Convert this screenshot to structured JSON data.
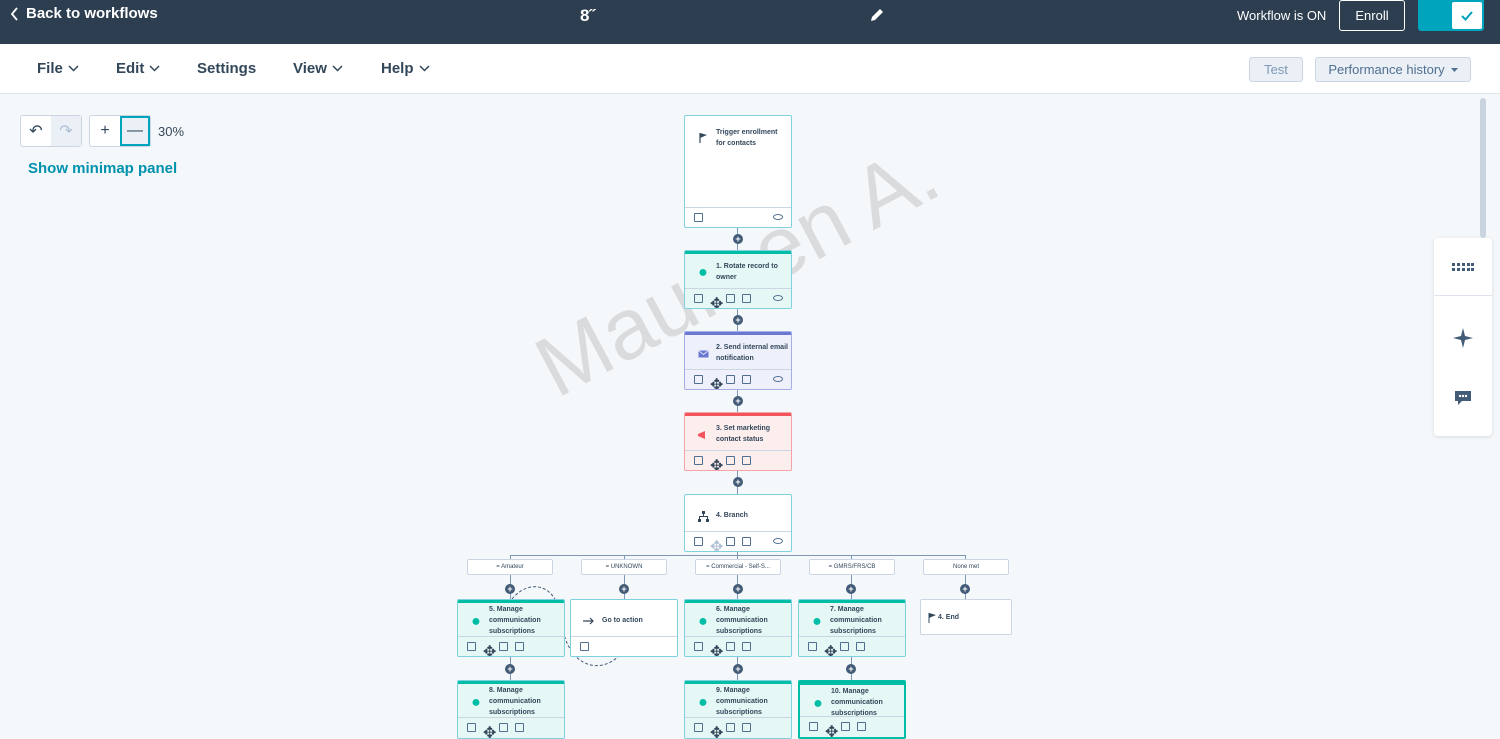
{
  "topbar": {
    "back_label": "Back to workflows",
    "workflow_name": "8˝",
    "status": "Workflow is ON",
    "enroll_label": "Enroll"
  },
  "menu": {
    "file": "File",
    "edit": "Edit",
    "settings": "Settings",
    "view": "View",
    "help": "Help",
    "test": "Test",
    "performance_history": "Performance history"
  },
  "canvas": {
    "zoom": "30%",
    "minimap_link": "Show minimap panel",
    "watermark": "Maureen A."
  },
  "nodes": {
    "trigger": "Trigger enrollment for contacts",
    "n1": "1. Rotate record to owner",
    "n2": "2. Send internal email notification",
    "n3": "3. Set marketing contact status",
    "n4": "4. Branch",
    "n5": "5. Manage communication subscriptions",
    "goto": "Go to action",
    "n6": "6. Manage communication subscriptions",
    "n7": "7. Manage communication subscriptions",
    "end": "4. End",
    "n8": "8. Manage communication subscriptions",
    "n9": "9. Manage communication subscriptions",
    "n10": "10. Manage communication subscriptions"
  },
  "branches": [
    "= Amateur",
    "= UNKNOWN",
    "= Commercial - Self-S...",
    "= GMRS/FRS/CB",
    "None met"
  ],
  "colors": {
    "topbar": "#2d3e50",
    "accent": "#00a4bd",
    "teal_node": "#00bda5",
    "email_node": "#6a78d1",
    "marketing_node": "#f2545b"
  }
}
